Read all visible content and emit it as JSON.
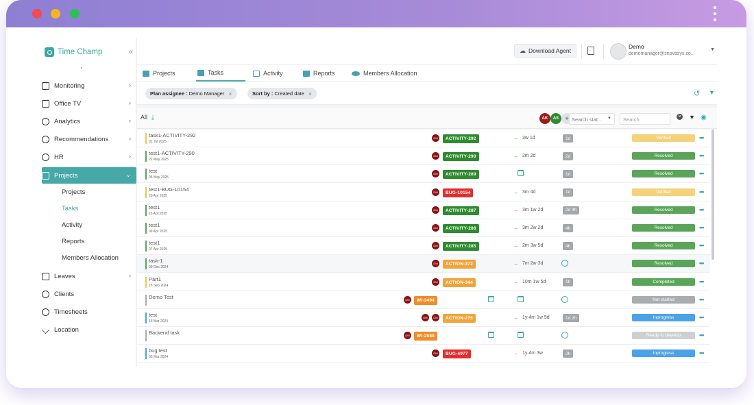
{
  "brand": {
    "name": "Time Champ"
  },
  "sidebar": {
    "items": [
      {
        "label": "Monitoring"
      },
      {
        "label": "Office TV"
      },
      {
        "label": "Analytics"
      },
      {
        "label": "Recommendations"
      },
      {
        "label": "HR"
      },
      {
        "label": "Projects"
      },
      {
        "label": "Leaves"
      },
      {
        "label": "Clients"
      },
      {
        "label": "Timesheets"
      },
      {
        "label": "Location"
      }
    ],
    "sub_items": [
      {
        "label": "Projects"
      },
      {
        "label": "Tasks"
      },
      {
        "label": "Activity"
      },
      {
        "label": "Reports"
      },
      {
        "label": "Members Allocation"
      }
    ]
  },
  "header": {
    "download_label": "Download Agent",
    "user_name": "Demo",
    "user_email": "demomanager@snovasys.co..."
  },
  "tabs": [
    {
      "label": "Projects"
    },
    {
      "label": "Tasks"
    },
    {
      "label": "Activity"
    },
    {
      "label": "Reports"
    },
    {
      "label": "Members Allocation"
    }
  ],
  "filters": {
    "chip1_key": "Plan assignee :",
    "chip1_value": "Demo Manager",
    "chip2_key": "Sort by :",
    "chip2_value": "Created date"
  },
  "toolbar": {
    "all_label": "All",
    "avatars": [
      "AK",
      "AS"
    ],
    "status_select": "Search stat...",
    "search_placeholder": "Search"
  },
  "colors": {
    "accent": "#3aa7a7",
    "activity": "#2e8b2e",
    "bug": "#e62d2d",
    "action": "#f2a33a",
    "wi": "#f28c28",
    "verified": "#f5d27a",
    "resolved": "#5aa55a",
    "completed": "#5aa55a",
    "not_started": "#a9adb1",
    "inprogress": "#4aa3e8",
    "ready": "#cdd0d3"
  },
  "rows": [
    {
      "name": "task1-ACTIVITY-292",
      "date": "01 Jul 2025",
      "tag": "ACTIVITY-292",
      "elapsed": "3w 1d",
      "est": "1d",
      "status": "Verified"
    },
    {
      "name": "test1-ACTIVITY-290",
      "date": "22 May 2025",
      "tag": "ACTIVITY-290",
      "elapsed": "2m 2d",
      "est": "2d",
      "status": "Resolved"
    },
    {
      "name": "test",
      "date": "06 May 2025",
      "tag": "ACTIVITY-289",
      "elapsed": "",
      "est": "1d",
      "status": "Resolved"
    },
    {
      "name": "test1-BUG-10154",
      "date": "20 Apr 2025",
      "tag": "BUG-10154",
      "elapsed": "3m 4d",
      "est": "1d",
      "status": "Verified"
    },
    {
      "name": "test1",
      "date": "15 Apr 2025",
      "tag": "ACTIVITY-287",
      "elapsed": "3m 1w 2d",
      "est": "2d 4h",
      "status": "Resolved"
    },
    {
      "name": "test1",
      "date": "09 Apr 2025",
      "tag": "ACTIVITY-286",
      "elapsed": "3m 2w 2d",
      "est": "4h",
      "status": "Resolved"
    },
    {
      "name": "test1",
      "date": "07 Apr 2025",
      "tag": "ACTIVITY-285",
      "elapsed": "2m 3w 5d",
      "est": "4h",
      "status": "Resolved"
    },
    {
      "name": "task-1",
      "date": "09 Dec 2024",
      "tag": "ACTION-372",
      "elapsed": "7m 2w 3d",
      "est": "",
      "status": "Resolved"
    },
    {
      "name": "Part1",
      "date": "15 Sep 2024",
      "tag": "ACTION-344",
      "elapsed": "10m 1w 5d",
      "est": "1h",
      "status": "Completed"
    },
    {
      "name": "Demo Test",
      "date": "",
      "tag": "WI-3494",
      "elapsed": "",
      "est": "",
      "status": "Not started"
    },
    {
      "name": "test",
      "date": "13 Mar 2024",
      "tag": "ACTION-275",
      "elapsed": "1y 4m 1w 5d",
      "est": "1d 2h",
      "status": "Inprogress"
    },
    {
      "name": "Backend task",
      "date": "",
      "tag": "WI-2888",
      "elapsed": "",
      "est": "",
      "status": "Ready to develop"
    },
    {
      "name": "bug test",
      "date": "05 Mar 2024",
      "tag": "BUG-4977",
      "elapsed": "1y 4m 3w",
      "est": "2h",
      "status": "Inprogress"
    }
  ],
  "row_avatar": "DM",
  "help_label": "Help"
}
